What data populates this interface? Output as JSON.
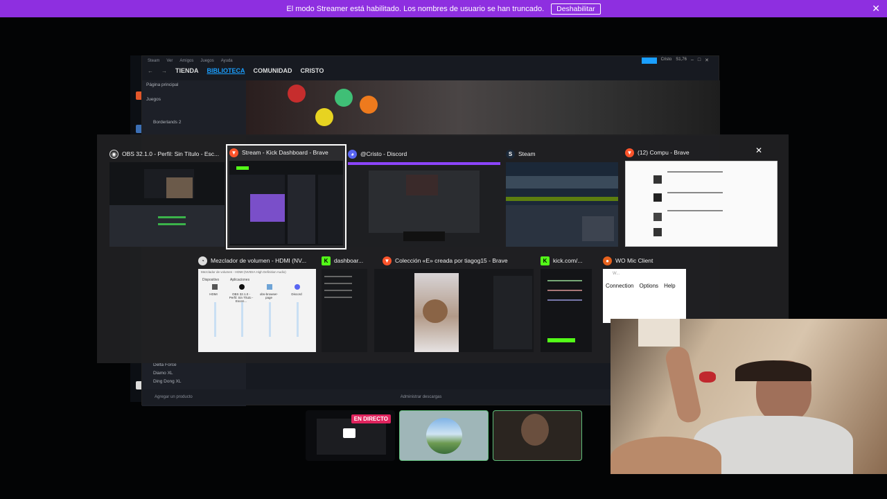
{
  "banner": {
    "message": "El modo Streamer está habilitado. Los nombres de usuario se han truncado.",
    "button": "Deshabilitar",
    "color": "#8e2fe0"
  },
  "steam": {
    "menu": [
      "Steam",
      "Ver",
      "Amigos",
      "Juegos",
      "Ayuda"
    ],
    "nav": [
      "TIENDA",
      "BIBLIOTECA",
      "COMUNIDAD",
      "CRISTO"
    ],
    "user": "Cristo",
    "balance": "S1,76",
    "home": "Página principal",
    "games_dropdown": "Juegos",
    "games": [
      "Borderlands 2",
      "Delta Force",
      "Diamo XL",
      "Ding Dong XL"
    ],
    "add_product": "Agregar un producto",
    "downloads": "Administrar descargas"
  },
  "switcher": {
    "row1": [
      {
        "title": "OBS 32.1.0 - Perfil: Sin Título - Esc...",
        "icon": "obs-icon"
      },
      {
        "title": "Stream - Kick Dashboard - Brave",
        "icon": "brave-icon"
      },
      {
        "title": "@Cristo - Discord",
        "icon": "discord-icon"
      },
      {
        "title": "Steam",
        "icon": "steam-icon"
      },
      {
        "title": "(12) Compu - Brave",
        "icon": "brave-icon"
      }
    ],
    "row2": [
      {
        "title": "Mezclador de volumen - HDMI (NV...",
        "icon": "mixer-icon"
      },
      {
        "title": "dashboar...",
        "icon": "kick-icon"
      },
      {
        "title": "Colección «E» creada por tiagog15 - Brave",
        "icon": "brave-icon"
      },
      {
        "title": "kick.com/...",
        "icon": "kick-icon"
      },
      {
        "title": "WO Mic Client",
        "icon": "mic-icon"
      }
    ],
    "mixer": {
      "title": "Mezclador de volumen - HDMI (NVIDIA High Definition Audio)",
      "device_label": "Dispositivo",
      "apps_label": "Aplicaciones",
      "channels": [
        "HDMI",
        "OBS 32.1.0 - Perfil: Sin Título - Escen...",
        "obs-browser-page",
        "Discord"
      ]
    },
    "womic_menu": [
      "Connection",
      "Options",
      "Help"
    ],
    "womic_window_title": "W..."
  },
  "live_badge": "EN DIRECTO"
}
